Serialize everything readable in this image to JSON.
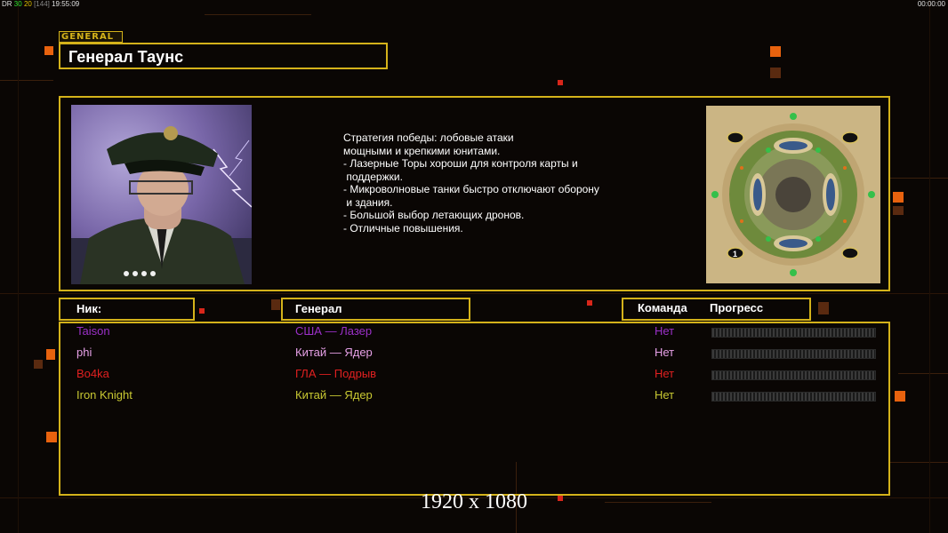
{
  "hud": {
    "left_prefix": "DR",
    "left_green": "30",
    "left_yellow": "20",
    "left_gray": "[144]",
    "left_time": "19:55:09",
    "right_time": "00:00:00"
  },
  "general": {
    "tag": "GENERAL",
    "name": "Генерал Таунс",
    "strategy_lines": [
      "Стратегия победы: лобовые атаки",
      "мощными и крепкими юнитами.",
      "",
      "- Лазерные Торы хороши для контроля карты и",
      " поддержки.",
      "- Микроволновые танки быстро отключают оборону",
      " и здания.",
      "",
      "- Большой выбор летающих дронов.",
      "- Отличные повышения."
    ]
  },
  "map": {
    "start_marker": "1"
  },
  "table": {
    "headers": {
      "nick": "Ник:",
      "general": "Генерал",
      "team": "Команда",
      "progress": "Прогресс"
    },
    "players": [
      {
        "nick": "Taison",
        "general": "США — Лазер",
        "team": "Нет",
        "progress": 0,
        "color": "#9b30c8"
      },
      {
        "nick": "phi",
        "general": "Китай — Ядер",
        "team": "Нет",
        "progress": 0,
        "color": "#e6a0e6"
      },
      {
        "nick": "Bo4ka",
        "general": "ГЛА — Подрыв",
        "team": "Нет",
        "progress": 0,
        "color": "#e02020"
      },
      {
        "nick": "Iron Knight",
        "general": "Китай — Ядер",
        "team": "Нет",
        "progress": 0,
        "color": "#c8c832"
      }
    ]
  },
  "resolution_label": "1920 x 1080",
  "colors": {
    "accent": "#d4b21a",
    "background": "#0a0604",
    "orange": "#e8620e"
  }
}
